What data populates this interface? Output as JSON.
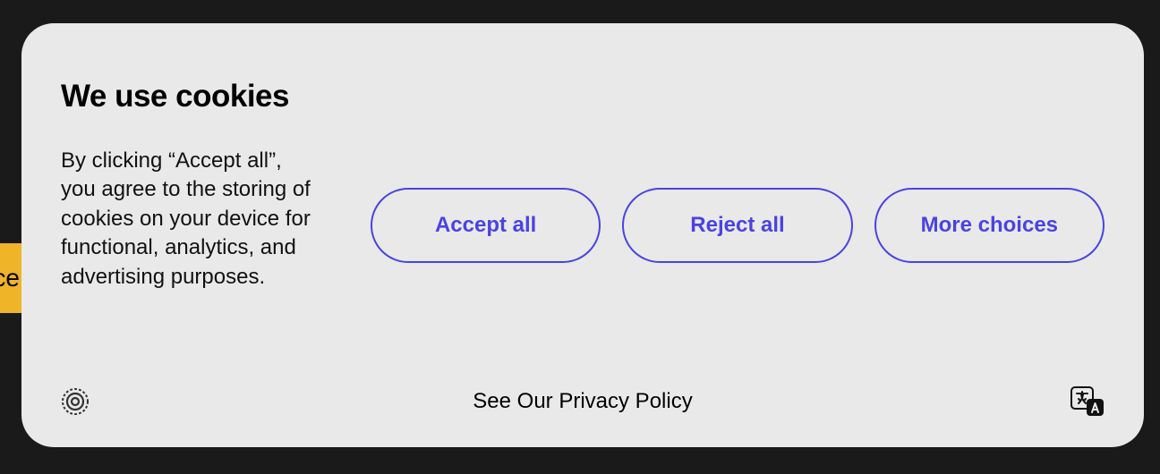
{
  "background": {
    "chip_text": "ce"
  },
  "dialog": {
    "title": "We use cookies",
    "description": "By clicking “Accept all”, you agree to the storing of cookies on your device for functional, analytics, and advertising purposes.",
    "buttons": {
      "accept": "Accept all",
      "reject": "Reject all",
      "more": "More choices"
    },
    "footer": {
      "policy_link": "See Our Privacy Policy"
    }
  }
}
